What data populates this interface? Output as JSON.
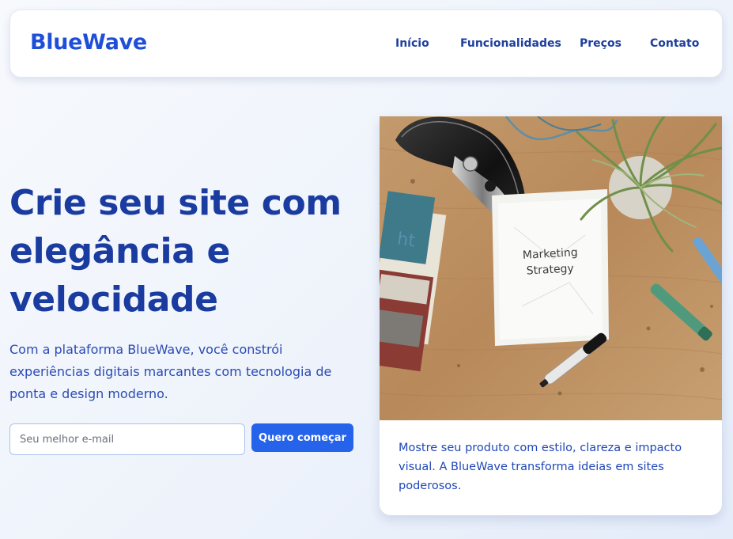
{
  "brand": {
    "name": "BlueWave"
  },
  "nav": {
    "items": [
      {
        "label": "Início"
      },
      {
        "label": "Funcionalidades"
      },
      {
        "label": "Preços"
      },
      {
        "label": "Contato"
      }
    ]
  },
  "hero": {
    "title_line1": "Crie seu site com",
    "title_line2": "elegância e",
    "title_line3": "velocidade",
    "description": "Com a plataforma BlueWave, você constrói experiências digitais marcantes com tecnologia de ponta e design moderno.",
    "email_placeholder": "Seu melhor e-mail",
    "email_value": "",
    "cta_label": "Quero começar"
  },
  "card": {
    "image_note_line1": "Marketing",
    "image_note_line2": "Strategy",
    "caption": "Mostre seu produto com estilo, clareza e impacto visual. A BlueWave transforma ideias em sites poderosos."
  },
  "colors": {
    "brand_blue": "#1f4fd8",
    "heading_blue": "#1a3b9f",
    "button_blue": "#2563eb"
  }
}
